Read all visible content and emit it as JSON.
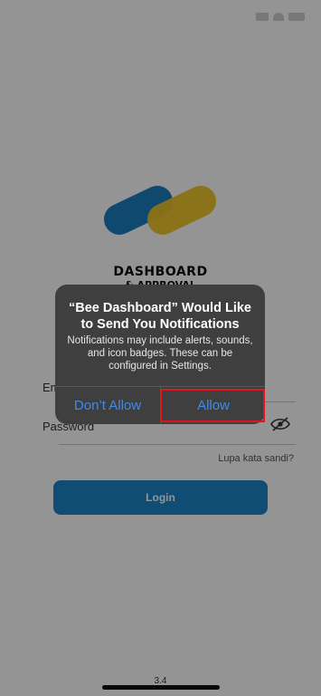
{
  "logo": {
    "text": "DASHBOARD",
    "subtext": "& APPROVAL",
    "colors": {
      "blue": "#1a7fc0",
      "yellow": "#f0c324"
    }
  },
  "form": {
    "email_label": "Email",
    "password_label": "Password",
    "password_icon": "eye-slash-icon",
    "forgot_label": "Lupa kata sandi?",
    "login_label": "Login"
  },
  "version": "3.4",
  "alert": {
    "title": "“Bee Dashboard” Would Like to Send You Notifications",
    "message": "Notifications may include alerts, sounds, and icon badges. These can be configured in Settings.",
    "dont_allow_label": "Don’t Allow",
    "allow_label": "Allow"
  },
  "colors": {
    "accent": "#1c86c8",
    "alert_button": "#3a8cf0",
    "highlight": "#e0161b"
  }
}
